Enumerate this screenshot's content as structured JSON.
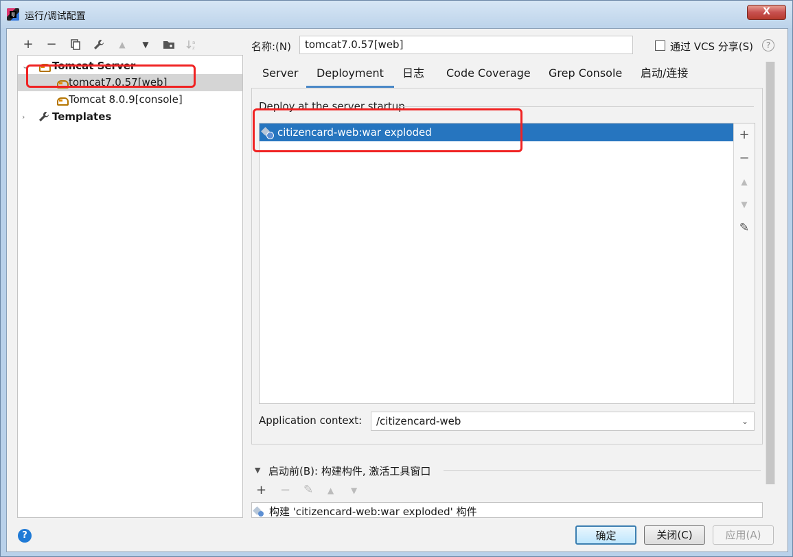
{
  "window": {
    "title": "运行/调试配置",
    "close_label": "X"
  },
  "left_toolbar": {
    "icons": [
      "add-icon",
      "remove-icon",
      "copy-icon",
      "wrench-icon",
      "move-up-icon",
      "move-down-icon",
      "folder-icon",
      "sort-icon"
    ],
    "add": "+",
    "remove": "−",
    "up": "▲",
    "down": "▼"
  },
  "tree": {
    "group": "Tomcat Server",
    "items": [
      {
        "label": "tomcat7.0.57[web]",
        "selected": true
      },
      {
        "label": "Tomcat 8.0.9[console]",
        "selected": false
      }
    ],
    "templates": "Templates"
  },
  "name_field": {
    "label": "名称:(N)",
    "value": "tomcat7.0.57[web]"
  },
  "vcs_share": {
    "label": "通过 VCS 分享(S)",
    "checked": false
  },
  "help_small": "?",
  "tabs": [
    {
      "label": "Server",
      "active": false
    },
    {
      "label": "Deployment",
      "active": true
    },
    {
      "label": "日志",
      "active": false
    },
    {
      "label": "Code Coverage",
      "active": false
    },
    {
      "label": "Grep Console",
      "active": false
    },
    {
      "label": "启动/连接",
      "active": false
    }
  ],
  "deployment": {
    "section_title": "Deploy at the server startup",
    "artifacts": [
      "citizencard-web:war exploded"
    ],
    "side_buttons": {
      "add": "+",
      "remove": "−",
      "up": "▲",
      "down": "▼",
      "edit": "✎"
    },
    "app_context_label": "Application context:",
    "app_context_value": "/citizencard-web"
  },
  "before_launch": {
    "label": "启动前(B): 构建构件, 激活工具窗口",
    "tools": {
      "add": "+",
      "remove": "−",
      "edit": "✎",
      "up": "▲",
      "down": "▼"
    },
    "items": [
      "构建 'citizencard-web:war exploded' 构件"
    ]
  },
  "footer": {
    "help": "?",
    "ok": "确定",
    "close": "关闭(C)",
    "apply": "应用(A)"
  },
  "colors": {
    "selection": "#2675bf",
    "active_tab_underline": "#4a88c7",
    "annotation": "#f02222"
  }
}
